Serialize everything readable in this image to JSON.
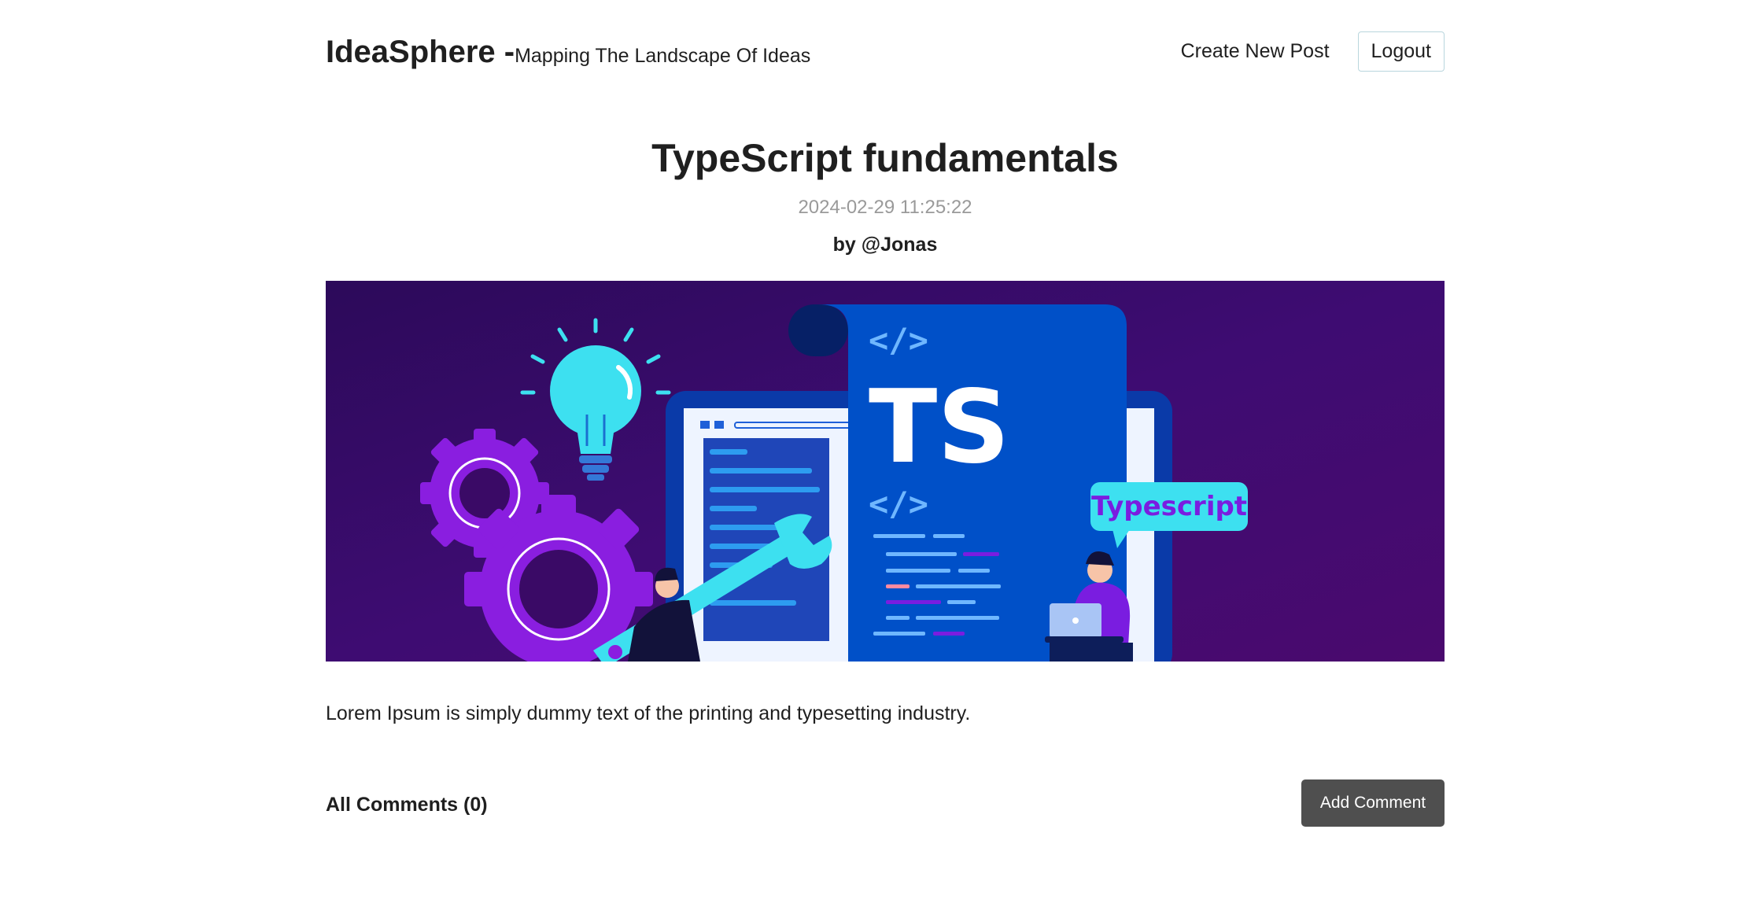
{
  "header": {
    "brand_name": "IdeaSphere -",
    "brand_tagline": "Mapping The Landscape Of Ideas",
    "create_post_label": "Create New Post",
    "logout_label": "Logout"
  },
  "post": {
    "title": "TypeScript fundamentals",
    "date": "2024-02-29 11:25:22",
    "author": "by @Jonas",
    "body": "Lorem Ipsum is simply dummy text of the printing and typesetting industry.",
    "banner": {
      "ts_label": "TS",
      "code_tag_top": "</>",
      "code_tag_bottom": "</>",
      "bubble_label": "Typescript"
    }
  },
  "comments": {
    "title": "All Comments (0)",
    "add_label": "Add Comment"
  },
  "colors": {
    "banner_bg": "#3a0a66",
    "doc_blue": "#0050c8",
    "accent_cyan": "#3de0f0",
    "gear_purple": "#8a1ee0",
    "button_dark": "#4f4f4f"
  }
}
